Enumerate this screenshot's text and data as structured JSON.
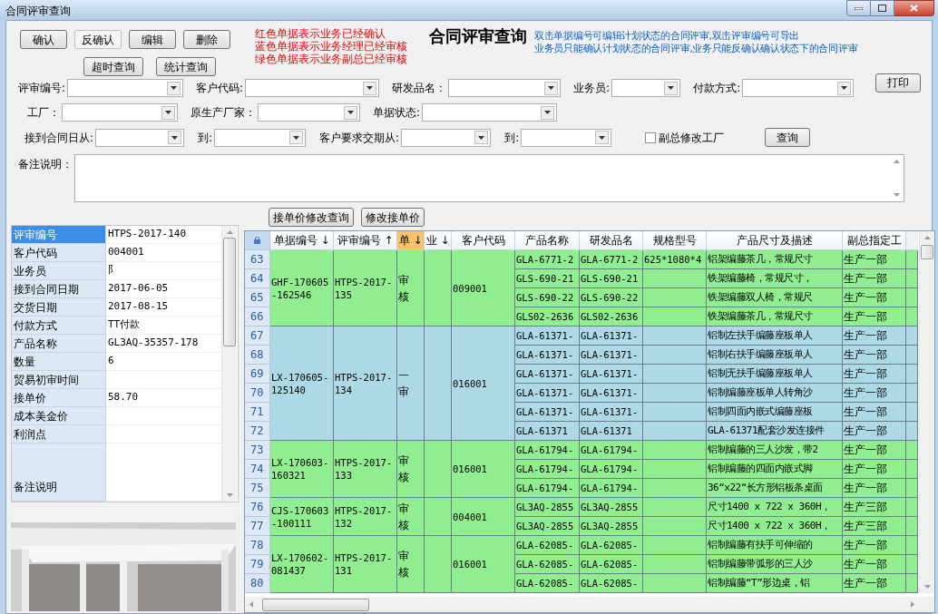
{
  "window": {
    "title": "合同评审查询"
  },
  "actions": [
    {
      "label": "确认",
      "disabled": false
    },
    {
      "label": "反确认",
      "disabled": true
    },
    {
      "label": "编辑",
      "disabled": false
    },
    {
      "label": "删除",
      "disabled": false
    }
  ],
  "actions_row2": [
    "超时查询",
    "统计查询"
  ],
  "legend": [
    "红色单据表示业务已经确认",
    "蓝色单据表示业务经理已经审核",
    "绿色单据表示业务副总已经审核"
  ],
  "heading": "合同评审查询",
  "hints": [
    "双击单据编号可编辑计划状态的合同评审,双击评审编号可导出",
    "业务员只能确认计划状态的合同评审,业务只能反确认确认状态下的合同评审"
  ],
  "filter_rows": [
    [
      {
        "kind": "combo",
        "label": "评审编号:"
      },
      {
        "kind": "combo",
        "label": "客户代码:"
      },
      {
        "kind": "combo",
        "label": "研发品名："
      },
      {
        "kind": "combo",
        "label": "业务员:"
      },
      {
        "kind": "combo",
        "label": "付款方式:"
      },
      {
        "kind": "button",
        "label": "打印"
      }
    ],
    [
      {
        "kind": "combo",
        "label": "工厂："
      },
      {
        "kind": "combo",
        "label": "原生产厂家："
      },
      {
        "kind": "combo",
        "label": "单据状态:"
      }
    ],
    [
      {
        "kind": "combo",
        "label": "接到合同日从:"
      },
      {
        "kind": "combo",
        "label": "到:"
      },
      {
        "kind": "combo",
        "label": "客户要求交期从:"
      },
      {
        "kind": "combo",
        "label": "到:"
      },
      {
        "kind": "checkbox",
        "label": "副总修改工厂",
        "checked": false
      },
      {
        "kind": "button",
        "label": "查询"
      }
    ]
  ],
  "remarks": {
    "label": "备注说明："
  },
  "details": [
    {
      "label": "评审编号",
      "value": "HTPS-2017-140",
      "selected": true
    },
    {
      "label": "客户代码",
      "value": "004001",
      "selected": false
    },
    {
      "label": "业务员",
      "value": "阝",
      "selected": false
    },
    {
      "label": "接到合同日期",
      "value": "2017-06-05",
      "selected": false
    },
    {
      "label": "交货日期",
      "value": "2017-08-15",
      "selected": false
    },
    {
      "label": "付款方式",
      "value": "TT付款",
      "selected": false
    },
    {
      "label": "产品名称",
      "value": "GL3AQ-35357-178",
      "selected": false
    },
    {
      "label": "数量",
      "value": "6",
      "selected": false
    },
    {
      "label": "贸易初审时间",
      "selected": false
    },
    {
      "label": "接单价",
      "value": "58.70",
      "selected": false
    },
    {
      "label": "成本美金价",
      "selected": false
    },
    {
      "label": "利润点",
      "selected": false
    },
    {
      "label": "备注说明",
      "selected": false,
      "kind": "memo"
    }
  ],
  "grid_buttons": [
    "接单价修改查询",
    "修改接单价"
  ],
  "grid": {
    "columns": [
      {
        "label": "单据编号 ↓",
        "selected": false
      },
      {
        "label": "评审编号 ↑",
        "selected": false
      },
      {
        "label": "单 ↓",
        "selected": true
      },
      {
        "label": "业 ↓",
        "selected": false
      },
      {
        "label": "客户代码",
        "selected": false
      },
      {
        "label": "产品名称",
        "selected": false
      },
      {
        "label": "研发品名",
        "selected": false
      },
      {
        "label": "规格型号",
        "selected": false
      },
      {
        "label": "产品尺寸及描述",
        "selected": false
      },
      {
        "label": "副总指定工",
        "selected": false
      }
    ],
    "groups": [
      {
        "doc_no": "GHF-170605-162546",
        "review_no": "HTPS-2017-135",
        "status": "审核",
        "customer": "009001",
        "color": "#90ee90",
        "items": [
          {
            "row": "63",
            "product": "GLA-6771-2",
            "rd_name": "GLA-6771-2",
            "spec": "625*1080*4",
            "desc": "铝架编藤茶几，常规尺寸",
            "factory": "生产一部"
          },
          {
            "row": "64",
            "product": "GLS-690-21",
            "rd_name": "GLS-690-21",
            "desc": "铁架编藤椅，常规尺寸，",
            "factory": "生产一部"
          },
          {
            "row": "65",
            "product": "GLS-690-22",
            "rd_name": "GLS-690-22",
            "desc": "铁架编藤双人椅，常规尺",
            "factory": "生产一部"
          },
          {
            "row": "66",
            "product": "GLS02-2636",
            "rd_name": "GLS02-2636",
            "desc": "铁架编藤茶几，常规尺寸",
            "factory": "生产一部"
          }
        ]
      },
      {
        "doc_no": "LX-170605-125140",
        "review_no": "HTPS-2017-134",
        "status": "一审",
        "customer": "016001",
        "color": "#add8e6",
        "items": [
          {
            "row": "67",
            "product": "GLA-61371-",
            "rd_name": "GLA-61371-",
            "desc": "铝制左扶手编藤座板单人",
            "factory": "生产一部"
          },
          {
            "row": "68",
            "product": "GLA-61371-",
            "rd_name": "GLA-61371-",
            "desc": "铝制右扶手编藤座板单人",
            "factory": "生产一部"
          },
          {
            "row": "69",
            "product": "GLA-61371-",
            "rd_name": "GLA-61371-",
            "desc": "铝制无扶手编藤座板单人",
            "factory": "生产一部"
          },
          {
            "row": "70",
            "product": "GLA-61371-",
            "rd_name": "GLA-61371-",
            "desc": "铝制编藤座板单人转角沙",
            "factory": "生产一部"
          },
          {
            "row": "71",
            "product": "GLA-61371-",
            "rd_name": "GLA-61371-",
            "desc": "铝制四面内嵌式编藤座板",
            "factory": "生产一部"
          },
          {
            "row": "72",
            "product": "GLA-61371",
            "rd_name": "GLA-61371",
            "desc": "GLA-61371配套沙发连接件",
            "factory": "生产一部"
          }
        ]
      },
      {
        "doc_no": "LX-170603-160321",
        "review_no": "HTPS-2017-133",
        "status": "审核",
        "customer": "016001",
        "color": "#90ee90",
        "items": [
          {
            "row": "73",
            "product": "GLA-61794-",
            "rd_name": "GLA-61794-",
            "desc": "铝制编藤的三人沙发，带2",
            "factory": "生产一部"
          },
          {
            "row": "74",
            "product": "GLA-61794-",
            "rd_name": "GLA-61794-",
            "desc": "铝制编藤的四面内嵌式脚",
            "factory": "生产一部"
          },
          {
            "row": "75",
            "product": "GLA-61794-",
            "rd_name": "GLA-61794-",
            "desc": "36“x22“长方形铝板条桌面",
            "factory": "生产一部"
          }
        ]
      },
      {
        "doc_no": "CJS-170603-100111",
        "review_no": "HTPS-2017-132",
        "status": "审核",
        "customer": "004001",
        "color": "#90ee90",
        "items": [
          {
            "row": "76",
            "product": "GL3AQ-2855",
            "rd_name": "GL3AQ-2855",
            "desc": "尺寸1400 x 722 x 360H，",
            "factory": "生产三部"
          },
          {
            "row": "77",
            "product": "GL3AQ-2855",
            "rd_name": "GL3AQ-2855",
            "desc": "尺寸1400 x 722 x 360H，",
            "factory": "生产三部"
          }
        ]
      },
      {
        "doc_no": "LX-170602-081437",
        "review_no": "HTPS-2017-131",
        "status": "审核",
        "customer": "016001",
        "color": "#90ee90",
        "items": [
          {
            "row": "78",
            "product": "GLA-62085-",
            "rd_name": "GLA-62085-",
            "desc": "铝制编藤有扶手可伸缩的",
            "factory": "生产一部"
          },
          {
            "row": "79",
            "product": "GLA-62085-",
            "rd_name": "GLA-62085-",
            "desc": "铝制编藤带弧形的三人沙",
            "factory": "生产一部"
          },
          {
            "row": "80",
            "product": "GLA-62085-",
            "rd_name": "GLA-62085-",
            "desc": "铝制编藤“T”形边桌，铝",
            "factory": "生产一部"
          }
        ]
      }
    ]
  }
}
